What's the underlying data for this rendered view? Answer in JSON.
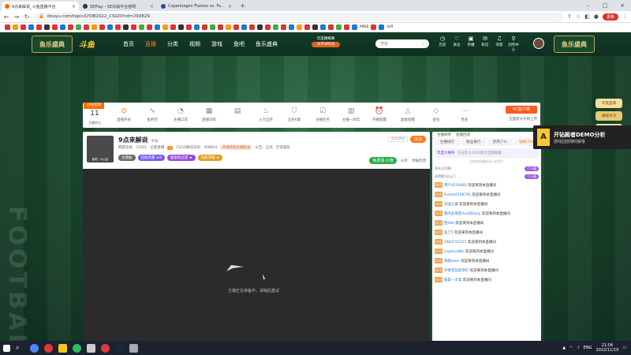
{
  "browser": {
    "tabs": [
      {
        "label": "9点来解说_斗鱼直播平台",
        "active": true
      },
      {
        "label": "5EPlay - 5E对战平台官网",
        "active": false
      },
      {
        "label": "Copenhagen Flames vs. Falco",
        "active": false
      }
    ],
    "url": "douyu.com/topic/LYDB2022_CSGO?rid=293829",
    "update_label": "更新"
  },
  "bookmarks": [
    "MWB",
    "ILM"
  ],
  "site": {
    "brand": "鱼乐盛典",
    "logo": "斗鱼",
    "menu": [
      {
        "label": "首页",
        "active": false
      },
      {
        "label": "直播",
        "active": true
      },
      {
        "label": "分类",
        "active": false
      },
      {
        "label": "视频",
        "active": false
      },
      {
        "label": "游戏",
        "active": false
      },
      {
        "label": "鱼吧",
        "active": false
      },
      {
        "label": "鱼乐盛典",
        "active": false
      }
    ],
    "year_badge": [
      "年度巅峰赛",
      "太平洋时间"
    ],
    "search_placeholder": "搜索",
    "right_icons": [
      "历史",
      "关注",
      "开播",
      "私信",
      "消息",
      "创作中心"
    ]
  },
  "toolbar": {
    "sub_label": "已经签到",
    "count": "11",
    "count_label": "主播积分",
    "items": [
      {
        "label": "直播开关",
        "icon": "toggle-icon",
        "on": true
      },
      {
        "label": "鱼吧吧",
        "icon": "wave-icon",
        "on": false
      },
      {
        "label": "主播口袋",
        "icon": "pocket-icon",
        "on": false
      },
      {
        "label": "直播日程",
        "icon": "calendar-icon",
        "on": false
      },
      {
        "label": "",
        "icon": "gift-icon",
        "on": false
      },
      {
        "label": "火力全开",
        "icon": "fire-icon",
        "on": false
      },
      {
        "label": "全民K歌",
        "icon": "shield-icon",
        "on": false
      },
      {
        "label": "主播任务",
        "icon": "task-icon",
        "on": false
      },
      {
        "label": "主播一周年",
        "icon": "book-icon",
        "on": false
      },
      {
        "label": "开播提醒",
        "icon": "alarm-icon",
        "on": false
      },
      {
        "label": "超级提醒",
        "icon": "bell-icon",
        "on": false
      },
      {
        "label": "鱼钻",
        "icon": "diamond-icon",
        "on": false
      },
      {
        "label": "更多",
        "icon": "more-icon",
        "on": false
      }
    ],
    "pc_button": "PC客户端",
    "pc_sub": "全面积分礼物上传"
  },
  "stream": {
    "avatar_caption": "鱼吧 · 小公会",
    "title": "9点来解说",
    "title_tag": "举报",
    "meta": {
      "category": "网游竞技 › CSGO › 全部直播",
      "level": "3",
      "fans_label": "CSGO解说夫妇",
      "fans_count": "308854",
      "sponsor": "开通贵族主播机会",
      "notice": "公告 · 正式",
      "extra": "告诉朋友"
    },
    "tags": [
      {
        "label": "主题曲",
        "color": "#6a6a6a"
      },
      {
        "label": "超级风暴 ★9",
        "color": "#7a5af0"
      },
      {
        "label": "超级粉丝团 ★",
        "color": "#9a4ad8"
      },
      {
        "label": "钻粉荣耀 ★",
        "color": "#e0a020"
      }
    ],
    "viewer_count": "426468",
    "follow_label": "关注",
    "action_buttons": {
      "green": "免费领·火箭",
      "share": "分享",
      "report": "举报反馈"
    },
    "video_message": "主播正在准备中，请稍后重试"
  },
  "chat": {
    "tabs": [
      {
        "label": "主播榜单",
        "on": false
      },
      {
        "label": "直播回放",
        "on": false
      }
    ],
    "subtabs": [
      {
        "label": "主播排行",
        "on": false
      },
      {
        "label": "粉丝排行",
        "on": false
      },
      {
        "label": "贵宾(71)",
        "on": false
      },
      {
        "label": "钻粉(73)",
        "on": true
      }
    ],
    "notice_title": "年度大事件",
    "notice_text": "点击参与1024和年度巅峰赛",
    "info": "当前房间最新进入的用户",
    "ranks": [
      {
        "user": "木头1234B",
        "badge": "二十级"
      },
      {
        "user": "还得第1旦公门",
        "badge": "三十级"
      }
    ],
    "messages": [
      {
        "tag": "LV.6",
        "user": "用户9234483",
        "text": "欢迎来到本直播间"
      },
      {
        "tag": "LV.4",
        "user": "fuai444108795",
        "text": "欢迎来到本直播间"
      },
      {
        "tag": "LV.6",
        "user": "天国之翼",
        "text": "欢迎来到本直播间"
      },
      {
        "tag": "LV.2",
        "user": "我的女朋友Ace的Daily",
        "text": "欢迎来到本直播间"
      },
      {
        "tag": "LV.7",
        "user": "西444",
        "text": "欢迎来到本直播间"
      },
      {
        "tag": "LV.5",
        "user": "鱼丁5",
        "text": "欢迎来到本直播间"
      },
      {
        "tag": "LV.6",
        "user": "1983152315",
        "text": "欢迎来到本直播间"
      },
      {
        "tag": "LV.5",
        "user": "CaptainWei",
        "text": "欢迎来到本直播间"
      },
      {
        "tag": "LV.6",
        "user": "海豚joker",
        "text": "欢迎来到本直播间"
      },
      {
        "tag": "LV.5",
        "user": "评委官哲起你们",
        "text": "欢迎来到本直播间"
      },
      {
        "tag": "LV.3",
        "user": "鼓掌一次类",
        "text": "欢迎来到本直播间"
      }
    ]
  },
  "side": {
    "items": [
      "年度盛典",
      "巅峰对决",
      "21日12点开赛",
      "名人堂"
    ]
  },
  "overlay": {
    "title": "开钻殿者DEMO分析",
    "subtitle": "游戏回放随时解答"
  },
  "footer_decor": "FOOTBALL",
  "taskbar": {
    "time": "21:04",
    "date": "2022/11/19",
    "lang": "ENG"
  }
}
